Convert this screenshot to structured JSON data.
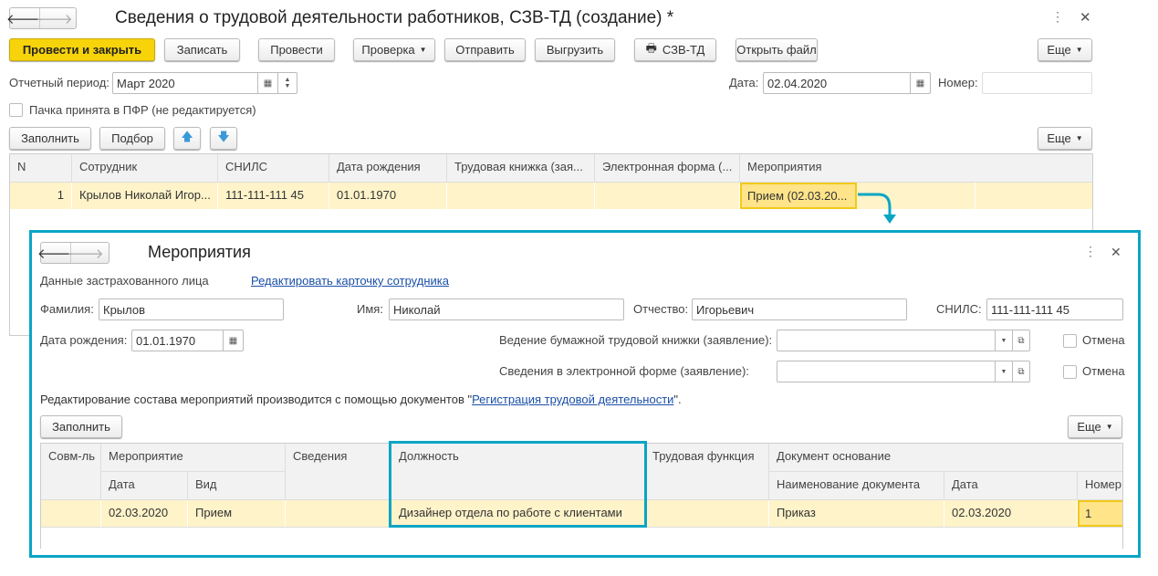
{
  "main": {
    "title": "Сведения о трудовой деятельности работников, СЗВ-ТД (создание) *",
    "toolbar": {
      "post_close": "Провести и закрыть",
      "save": "Записать",
      "post": "Провести",
      "check": "Проверка",
      "send": "Отправить",
      "export": "Выгрузить",
      "print": "СЗВ-ТД",
      "open_file": "Открыть файл",
      "more": "Еще"
    },
    "period_label": "Отчетный период:",
    "period_value": "Март 2020",
    "date_label": "Дата:",
    "date_value": "02.04.2020",
    "number_label": "Номер:",
    "number_value": "",
    "accepted_label": "Пачка принята в ПФР (не редактируется)",
    "accepted_checked": false,
    "table_toolbar": {
      "fill": "Заполнить",
      "select": "Подбор",
      "more": "Еще"
    },
    "table": {
      "columns": [
        "N",
        "Сотрудник",
        "СНИЛС",
        "Дата рождения",
        "Трудовая книжка (зая...",
        "Электронная форма (...",
        "Мероприятия"
      ],
      "rows": [
        [
          "1",
          "Крылов Николай Игор...",
          "111-111-111 45",
          "01.01.1970",
          "",
          "",
          "Прием (02.03.20..."
        ]
      ]
    }
  },
  "dialog": {
    "title": "Мероприятия",
    "insured_label": "Данные застрахованного лица",
    "edit_link": "Редактировать карточку сотрудника",
    "surname_label": "Фамилия:",
    "surname": "Крылов",
    "name_label": "Имя:",
    "name": "Николай",
    "patronymic_label": "Отчество:",
    "patronymic": "Игорьевич",
    "snils_label": "СНИЛС:",
    "snils": "111-111-111 45",
    "birth_label": "Дата рождения:",
    "birth": "01.01.1970",
    "paper_label": "Ведение бумажной трудовой книжки (заявление):",
    "paper_value": "",
    "electronic_label": "Сведения в электронной форме (заявление):",
    "electronic_value": "",
    "cancel_label": "Отмена",
    "note_prefix": "Редактирование состава мероприятий производится с помощью документов \"",
    "note_link": "Регистрация трудовой деятельности",
    "note_suffix": "\".",
    "fill": "Заполнить",
    "more": "Еще",
    "table": {
      "h": {
        "combo": "Совм-ль",
        "event": "Мероприятие",
        "event_date": "Дата",
        "event_kind": "Вид",
        "info": "Сведения",
        "position": "Должность",
        "function": "Трудовая функция",
        "basis": "Документ основание",
        "doc_name": "Наименование документа",
        "doc_date": "Дата",
        "doc_num": "Номер"
      },
      "row": {
        "combo": "",
        "event_date": "02.03.2020",
        "event_kind": "Прием",
        "info": "",
        "position": "Дизайнер отдела по работе с клиентами",
        "function": "",
        "doc_name": "Приказ",
        "doc_date": "02.03.2020",
        "doc_num": "1"
      }
    }
  },
  "colors": {
    "accent": "#0aa5c5",
    "primary_button": "#f7d40a",
    "row_highlight": "#fff3c9",
    "selected_cell": "#ffe48a"
  }
}
